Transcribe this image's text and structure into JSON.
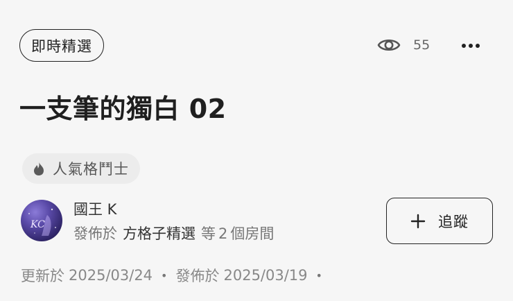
{
  "header": {
    "category_tag": "即時精選",
    "view_count": "55",
    "eye_icon": "eye-icon",
    "more_icon": "more-horizontal-icon"
  },
  "article": {
    "title": "一支筆的獨白 02",
    "badge_label": "人氣格鬥士",
    "badge_icon": "flame-icon"
  },
  "author": {
    "name": "國王 K",
    "published_prefix": "發佈於",
    "published_in": "方格子精選",
    "rooms_prefix": "等",
    "rooms_count": "2",
    "rooms_suffix": "個房間",
    "follow_label": "追蹤",
    "follow_icon": "plus-icon",
    "avatar_text": "KC"
  },
  "dates": {
    "updated_label": "更新於",
    "updated_date": "2025/03/24",
    "published_label": "發佈於",
    "published_date": "2025/03/19",
    "separator": "•"
  }
}
